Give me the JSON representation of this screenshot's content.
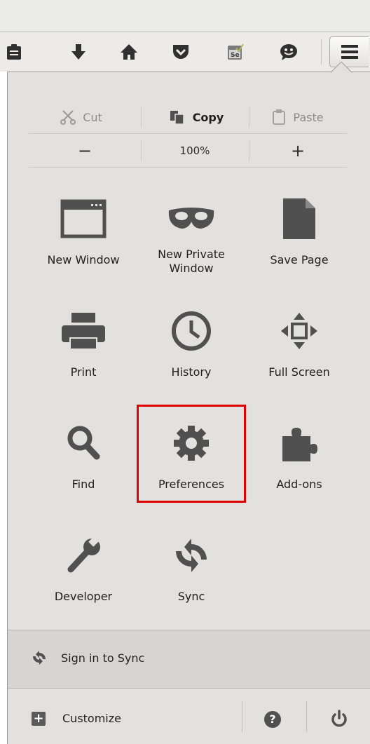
{
  "toolbar": {
    "icons": [
      "reading-list-icon",
      "download-icon",
      "home-icon",
      "pocket-icon",
      "selenium-icon",
      "chat-icon",
      "menu-icon"
    ]
  },
  "edit": {
    "cut_label": "Cut",
    "copy_label": "Copy",
    "paste_label": "Paste"
  },
  "zoom": {
    "minus_label": "−",
    "level": "100%",
    "plus_label": "+"
  },
  "grid": {
    "new_window": "New Window",
    "new_private_window": "New Private\nWindow",
    "save_page": "Save Page",
    "print": "Print",
    "history": "History",
    "full_screen": "Full Screen",
    "find": "Find",
    "preferences": "Preferences",
    "addons": "Add-ons",
    "developer": "Developer",
    "sync": "Sync"
  },
  "sync_bar": {
    "label": "Sign in to Sync"
  },
  "footer": {
    "customize_label": "Customize",
    "customize_glyph": "+",
    "help_glyph": "?"
  },
  "colors": {
    "highlight": "#e00000",
    "icon": "#505050",
    "panel_bg": "#e2e1dd"
  }
}
